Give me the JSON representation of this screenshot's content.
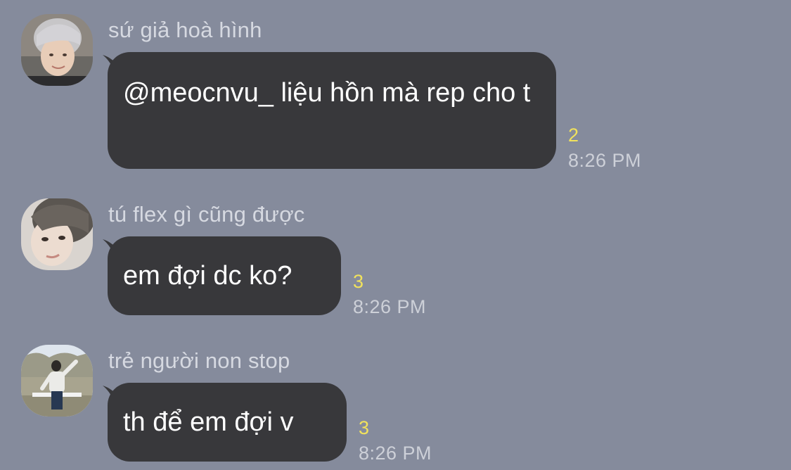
{
  "theme": {
    "background": "#858b9c",
    "bubble": "#38383b",
    "bubble_text": "#ffffff",
    "sender_text": "#d6d9e1",
    "unread_color": "#f1e25c",
    "time_color": "#cdd0d8"
  },
  "messages": [
    {
      "sender": "sứ giả hoà hình",
      "text": "@meocnvu_ liệu hồn mà rep cho t",
      "unread": "2",
      "time": "8:26 PM",
      "avatar_icon": "profile-photo-silver-hair"
    },
    {
      "sender": "tú flex gì cũng được",
      "text": "em đợi dc ko?",
      "unread": "3",
      "time": "8:26 PM",
      "avatar_icon": "profile-photo-closeup"
    },
    {
      "sender": "trẻ người non stop",
      "text": "th để em đợi v",
      "unread": "3",
      "time": "8:26 PM",
      "avatar_icon": "profile-photo-outdoor"
    }
  ]
}
